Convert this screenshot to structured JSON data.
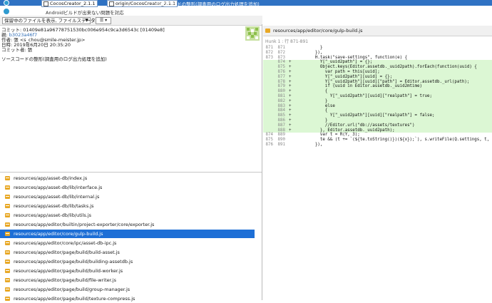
{
  "graph": {
    "selected_tags": [
      "CocosCreator_2.1.1",
      "origin/CocosCreator_2.1.1"
    ],
    "selected_message": "ソースコードの整形(調査用のログ出力処理を追加)",
    "next_message": "Androidビルドが出来ない問題を対応",
    "colors": {
      "selected_bg": "#2f72c3",
      "node": "#2f9bd0"
    }
  },
  "toolbar": {
    "view_select_value": "保留中のファイルを表示, ファイルステータス順",
    "menu_label": "☰ ▾"
  },
  "commit": {
    "line_commit": "コミット: 01409e81a96778751530bc006e954c9ca3d6543c [01409e8]",
    "line_parent_label": "親: ",
    "line_parent_value": "b3023a46f7",
    "line_author": "作者: 張 <s_chou@smile-meister.jp>",
    "line_date": "日時: 2019年6月20日 20:35:20",
    "line_committer": "コミット者: 張",
    "message": "ソースコードの整形(調査用のログ出力処理を追加)"
  },
  "files": [
    "resources/app/asset-db/index.js",
    "resources/app/asset-db/lib/interface.js",
    "resources/app/asset-db/lib/internal.js",
    "resources/app/asset-db/lib/tasks.js",
    "resources/app/asset-db/lib/utils.js",
    "resources/app/editor/builtin/project-exporter/core/exporter.js",
    "resources/app/editor/core/gulp-build.js",
    "resources/app/editor/core/ipc/asset-db-ipc.js",
    "resources/app/editor/page/build/build-asset.js",
    "resources/app/editor/page/build/building-assetdb.js",
    "resources/app/editor/page/build/build-worker.js",
    "resources/app/editor/page/build/file-writer.js",
    "resources/app/editor/page/build/group-manager.js",
    "resources/app/editor/page/build/texture-compress.js"
  ],
  "selected_file_index": 6,
  "diff": {
    "path": "resources/app/editor/core/gulp-build.js",
    "hunk_label": "Hunk 1 : 行 871-891",
    "lines": [
      {
        "o": "871",
        "n": "871",
        "m": "",
        "c": "        }"
      },
      {
        "o": "872",
        "n": "872",
        "m": "",
        "c": "      }),"
      },
      {
        "o": "873",
        "n": "873",
        "m": "",
        "c": "      H.task(\"save-settings\", function(e) {"
      },
      {
        "o": "",
        "n": "874",
        "m": "+",
        "c": "        Y[\"_uuid2path\"] = {};"
      },
      {
        "o": "",
        "n": "875",
        "m": "+",
        "c": "        Object.keys(Editor.assetdb._uuid2path).forEach(function(uuid) {"
      },
      {
        "o": "",
        "n": "876",
        "m": "+",
        "c": "          var path = this[uuid];"
      },
      {
        "o": "",
        "n": "877",
        "m": "+",
        "c": "          Y[\"_uuid2path\"][uuid] = {};"
      },
      {
        "o": "",
        "n": "878",
        "m": "+",
        "c": "          Y[\"_uuid2path\"][uuid][\"path\"] = Editor.assetdb._url(path);"
      },
      {
        "o": "",
        "n": "879",
        "m": "+",
        "c": "          if (uuid in Editor.assetdb._uuid2mtime)"
      },
      {
        "o": "",
        "n": "880",
        "m": "+",
        "c": "          {"
      },
      {
        "o": "",
        "n": "881",
        "m": "+",
        "c": "            Y[\"_uuid2path\"][uuid][\"realpath\"] = true;"
      },
      {
        "o": "",
        "n": "882",
        "m": "+",
        "c": "          }"
      },
      {
        "o": "",
        "n": "883",
        "m": "+",
        "c": "          else"
      },
      {
        "o": "",
        "n": "884",
        "m": "+",
        "c": "          {"
      },
      {
        "o": "",
        "n": "885",
        "m": "+",
        "c": "            Y[\"_uuid2path\"][uuid][\"realpath\"] = false;"
      },
      {
        "o": "",
        "n": "886",
        "m": "+",
        "c": "          }"
      },
      {
        "o": "",
        "n": "887",
        "m": "+",
        "c": "          //Editor.url(\"db://assets/textures\")"
      },
      {
        "o": "",
        "n": "888",
        "m": "+",
        "c": "        }, Editor.assetdb._uuid2path);"
      },
      {
        "o": "874",
        "n": "889",
        "m": "",
        "c": "        var t = R(Y, 3);"
      },
      {
        "o": "875",
        "n": "890",
        "m": "",
        "c": "        te && (t += `(${te.toString()})(${x});`), s.writeFile(Q.settings, t, e);"
      },
      {
        "o": "876",
        "n": "891",
        "m": "",
        "c": "      }),"
      }
    ]
  }
}
